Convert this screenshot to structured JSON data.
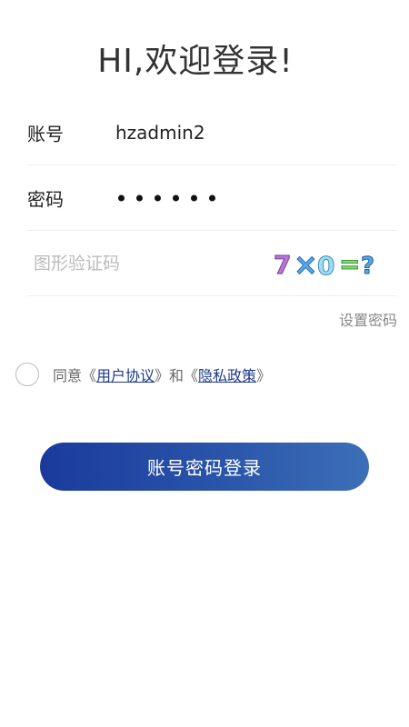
{
  "header": {
    "title": "HI,欢迎登录!"
  },
  "form": {
    "account": {
      "label": "账号",
      "value": "hzadmin2"
    },
    "password": {
      "label": "密码",
      "masked_length": 6
    },
    "captcha": {
      "placeholder": "图形验证码",
      "image_text": {
        "operand_1": "7",
        "operator": "×",
        "operand_2": "0",
        "equals": "=",
        "question": "?"
      }
    },
    "set_password_link": "设置密码"
  },
  "agreement": {
    "prefix": "同意《",
    "user_agreement": "用户协议",
    "middle": "》和《",
    "privacy_policy": "隐私政策",
    "suffix": "》"
  },
  "login_button": {
    "label": "账号密码登录"
  },
  "colors": {
    "button_gradient_start": "#1a3a9c",
    "button_gradient_end": "#3d6fb8",
    "link": "#1d3a8a",
    "placeholder": "#bbbbbb"
  }
}
